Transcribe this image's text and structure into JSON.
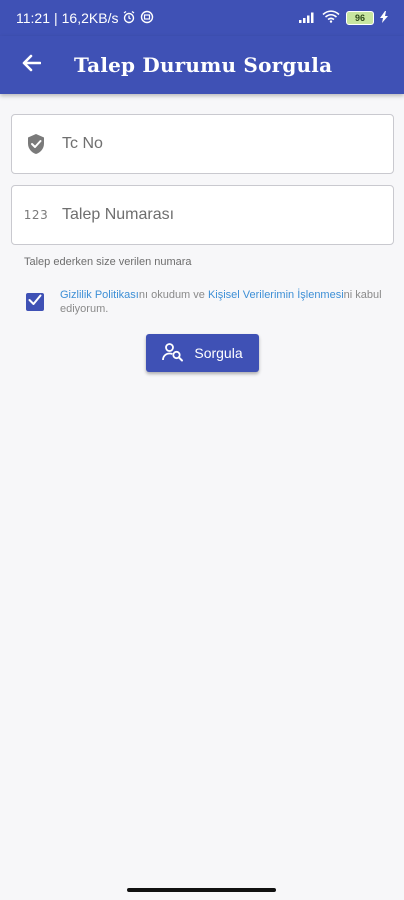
{
  "status_bar": {
    "time": "11:21",
    "speed": "16,2KB/s",
    "battery": "96"
  },
  "app_bar": {
    "title": "Talep Durumu Sorgula",
    "back_icon": "arrow-left-icon"
  },
  "form": {
    "tc_no": {
      "placeholder": "Tc No",
      "value": "",
      "icon": "shield-icon"
    },
    "request_number": {
      "placeholder": "Talep Numarası",
      "value": "",
      "icon": "numeric-icon",
      "icon_text": "123"
    },
    "helper_text": "Talep ederken size verilen numara",
    "consent": {
      "checked": true,
      "link1": "Gizlilik Politikası",
      "text1": "nı okudum ve ",
      "link2": "Kişisel Verilerimin İşlenmesi",
      "text2": "ni kabul ediyorum."
    },
    "submit_label": "Sorgula"
  },
  "colors": {
    "primary": "#3f51b5",
    "link": "#3d8fd6",
    "background": "#f7f7f9"
  }
}
